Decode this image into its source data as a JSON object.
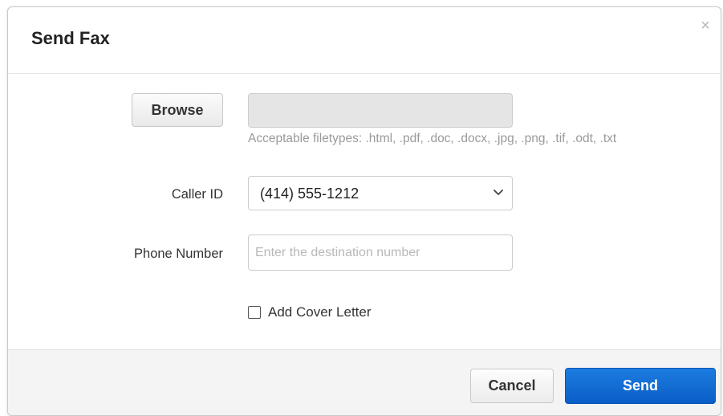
{
  "dialog": {
    "title": "Send Fax",
    "close_glyph": "×",
    "close_icon": "close-icon"
  },
  "file": {
    "browse_label": "Browse",
    "selected_file": "",
    "help_text": "Acceptable filetypes: .html, .pdf, .doc, .docx, .jpg, .png, .tif, .odt, .txt"
  },
  "caller_id": {
    "label": "Caller ID",
    "selected": "(414) 555-1212",
    "icon": "chevron-down-icon"
  },
  "phone_number": {
    "label": "Phone Number",
    "value": "",
    "placeholder": "Enter the destination number"
  },
  "cover_letter": {
    "label": "Add Cover Letter",
    "checked": false
  },
  "footer": {
    "cancel_label": "Cancel",
    "send_label": "Send"
  },
  "colors": {
    "primary": "#0a66d0",
    "footer_bg": "#f4f4f4",
    "file_box_bg": "#e5e5e5"
  }
}
